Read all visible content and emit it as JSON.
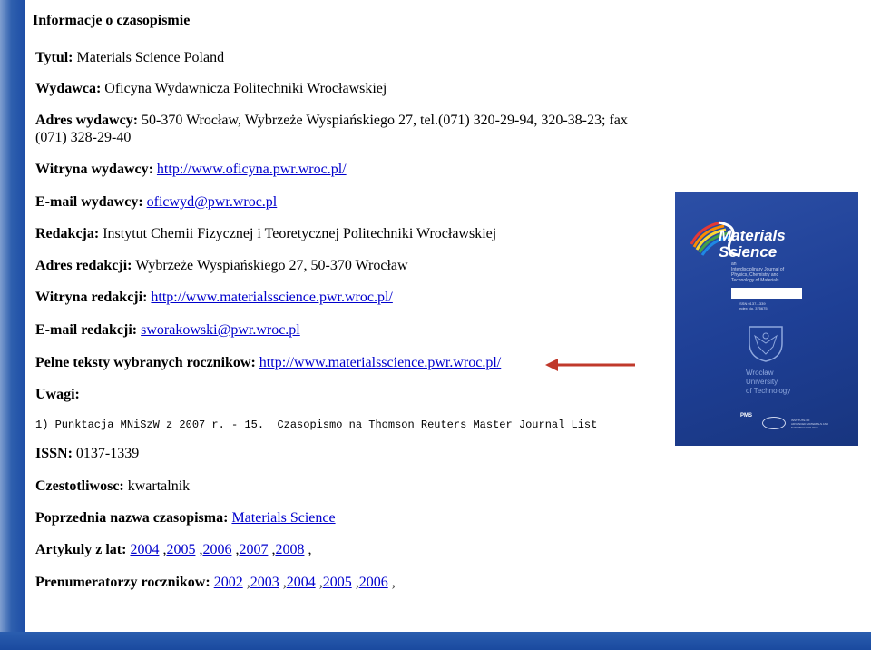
{
  "header": {
    "title": "Informacje o czasopismie"
  },
  "fields": {
    "tytul": {
      "label": "Tytul:",
      "value": "Materials Science Poland"
    },
    "wydawca": {
      "label": "Wydawca:",
      "value": "Oficyna Wydawnicza Politechniki Wrocławskiej"
    },
    "adres_wydawcy": {
      "label": "Adres wydawcy:",
      "value_line1": "50-370 Wrocław, Wybrzeże Wyspiańskiego 27, tel.(071) 320-29-94, 320-38-23; fax",
      "value_line2": "(071) 328-29-40"
    },
    "witryna_wydawcy": {
      "label": "Witryna wydawcy:",
      "link": "http://www.oficyna.pwr.wroc.pl/"
    },
    "email_wydawcy": {
      "label": "E-mail wydawcy:",
      "link": "oficwyd@pwr.wroc.pl"
    },
    "redakcja": {
      "label": "Redakcja:",
      "value": "Instytut Chemii Fizycznej i Teoretycznej Politechniki Wrocławskiej"
    },
    "adres_redakcji": {
      "label": "Adres redakcji:",
      "value": "Wybrzeże Wyspiańskiego 27, 50-370 Wrocław"
    },
    "witryna_redakcji": {
      "label": "Witryna redakcji:",
      "link": "http://www.materialsscience.pwr.wroc.pl/"
    },
    "email_redakcji": {
      "label": "E-mail redakcji:",
      "link": "sworakowski@pwr.wroc.pl"
    },
    "pelne_teksty": {
      "label": "Pelne teksty wybranych rocznikow:",
      "link": "http://www.materialsscience.pwr.wroc.pl/"
    },
    "uwagi": {
      "label": "Uwagi:",
      "note": "1) Punktacja MNiSzW z 2007 r. - 15.  Czasopismo na Thomson Reuters Master Journal List"
    },
    "issn": {
      "label": "ISSN:",
      "value": "0137-1339"
    },
    "czestotliwosc": {
      "label": "Czestotliwosc:",
      "value": "kwartalnik"
    },
    "poprzednia_nazwa": {
      "label": "Poprzednia nazwa czasopisma:",
      "link": "Materials Science"
    },
    "artykuly": {
      "label": "Artykuly z lat:",
      "years": [
        "2004",
        "2005",
        "2006",
        "2007",
        "2008"
      ]
    },
    "prenumeratorzy": {
      "label": "Prenumeratorzy rocznikow:",
      "years": [
        "2002",
        "2003",
        "2004",
        "2005",
        "2006"
      ]
    }
  },
  "cover": {
    "logo_line1": "Materials",
    "logo_line2": "Science",
    "subtitle_line1": "an",
    "subtitle_line2": "Interdisciplinary Journal of",
    "subtitle_line3": "Physics, Chemistry and",
    "subtitle_line4": "Technology of Materials",
    "issn_line1": "ISSN 0137-1339",
    "issn_line2": "Index No. 375675",
    "university_line1": "Wrocław",
    "university_line2": "University",
    "university_line3": "of Technology",
    "pms": "PMS",
    "institute_line1": "INSTITUTE OF",
    "institute_line2": "ADVANCED MATERIALS AND",
    "institute_line3": "NANOTECHNOLOGY"
  },
  "colors": {
    "link": "#0000cc",
    "arrow": "#c0392b",
    "cover_bg": "#1e3f95",
    "frame_blue": "#1d4ea6"
  }
}
